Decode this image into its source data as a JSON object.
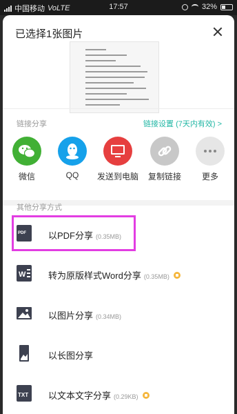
{
  "status_bar": {
    "carrier": "中国移动",
    "network": "VoLTE",
    "time": "17:57",
    "battery": "32%",
    "battery_level": 0.32
  },
  "sheet": {
    "title": "已选择1张图片"
  },
  "link_share": {
    "label": "链接分享",
    "settings": "链接设置 (7天内有效) >"
  },
  "share_targets": [
    {
      "label": "微信",
      "icon": "wechat-icon",
      "color": "#41b035"
    },
    {
      "label": "QQ",
      "icon": "qq-icon",
      "color": "#16a1ea"
    },
    {
      "label": "发送到电脑",
      "icon": "computer-icon",
      "color": "#e63f3f"
    },
    {
      "label": "复制链接",
      "icon": "link-icon",
      "color": "#c8c8c8"
    },
    {
      "label": "更多",
      "icon": "more-icon",
      "color": "#e6e6e6"
    }
  ],
  "other_share": {
    "label": "其他分享方式",
    "options": [
      {
        "label": "以PDF分享",
        "size": "(0.35MB)",
        "icon": "pdf-icon",
        "premium": false,
        "highlighted": true
      },
      {
        "label": "转为原版样式Word分享",
        "size": "(0.35MB)",
        "icon": "word-icon",
        "premium": true
      },
      {
        "label": "以图片分享",
        "size": "(0.34MB)",
        "icon": "image-icon",
        "premium": false
      },
      {
        "label": "以长图分享",
        "size": "",
        "icon": "long-image-icon",
        "premium": false
      },
      {
        "label": "以文本文字分享",
        "size": "(0.29KB)",
        "icon": "txt-icon",
        "premium": true
      }
    ]
  },
  "colors": {
    "accent": "#23b7a5",
    "highlight": "#e23de2",
    "premium": "#f5b63c"
  }
}
